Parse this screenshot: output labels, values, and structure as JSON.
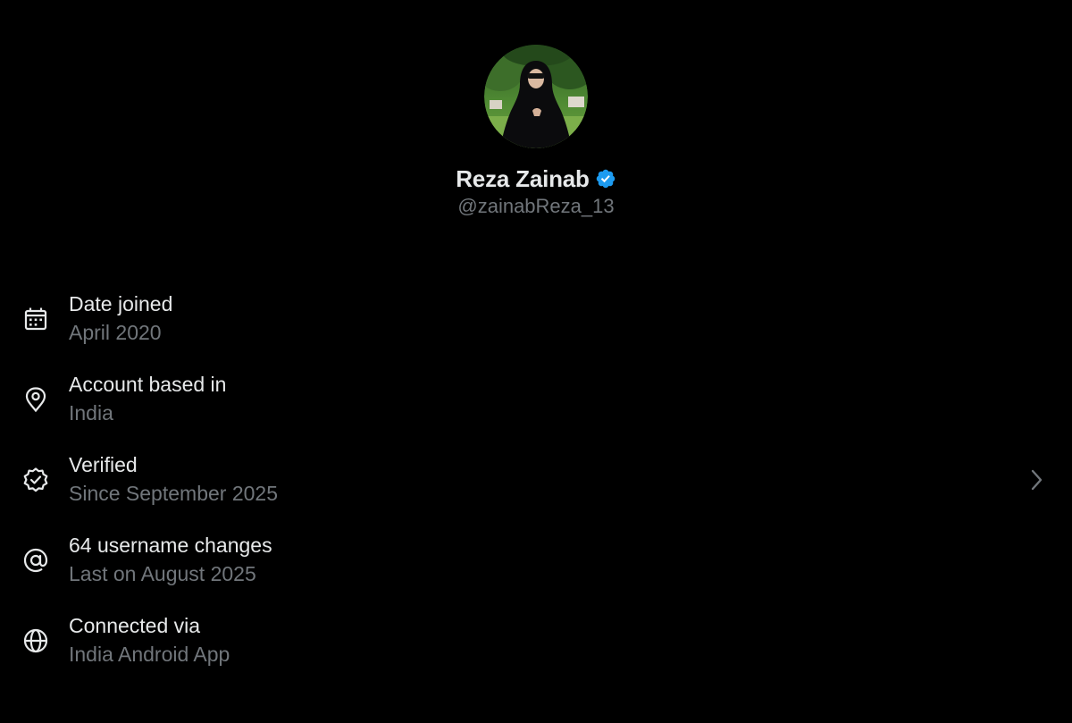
{
  "profile": {
    "display_name": "Reza Zainab",
    "handle": "@zainabReza_13",
    "verified_badge_color": "#1d9bf0",
    "avatar_icon": "profile-photo"
  },
  "info_rows": [
    {
      "icon": "calendar-icon",
      "title": "Date joined",
      "subtitle": "April 2020"
    },
    {
      "icon": "location-pin-icon",
      "title": "Account based in",
      "subtitle": "India"
    },
    {
      "icon": "verified-seal-icon",
      "title": "Verified",
      "subtitle": "Since September 2025",
      "has_chevron": true
    },
    {
      "icon": "at-sign-icon",
      "title": "64 username changes",
      "subtitle": "Last on August 2025"
    },
    {
      "icon": "globe-icon",
      "title": "Connected via",
      "subtitle": "India Android App"
    }
  ],
  "colors": {
    "background": "#000000",
    "primary_text": "#e7e9ea",
    "secondary_text": "#71767b",
    "accent": "#1d9bf0"
  }
}
